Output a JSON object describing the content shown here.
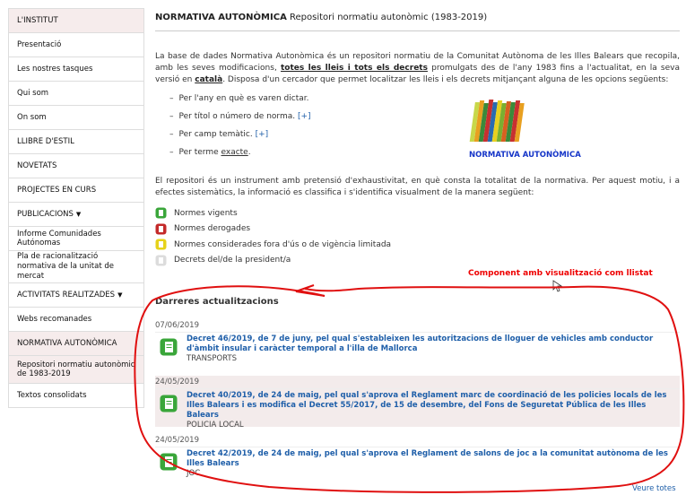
{
  "sidebar": {
    "items": [
      {
        "label": "L'INSTITUT",
        "type": "head"
      },
      {
        "label": "Presentació"
      },
      {
        "label": "Les nostres tasques"
      },
      {
        "label": "Qui som"
      },
      {
        "label": "On som"
      },
      {
        "label": "LLIBRE D'ESTIL"
      },
      {
        "label": "NOVETATS"
      },
      {
        "label": "PROJECTES EN CURS"
      },
      {
        "label": "PUBLICACIONS"
      },
      {
        "label": "Informe Comunidades Autónomas"
      },
      {
        "label": "Pla de racionalització normativa de la unitat de mercat"
      },
      {
        "label": "ACTIVITATS REALITZADES"
      },
      {
        "label": "Webs recomanades"
      },
      {
        "label": "NORMATIVA AUTONÒMICA"
      },
      {
        "label": "Repositori normatiu autonòmic de 1983-2019"
      },
      {
        "label": "Textos consolidats"
      }
    ],
    "caret": "▼"
  },
  "main": {
    "title_bold": "NORMATIVA AUTONÒMICA",
    "title_rest": " Repositori normatiu autonòmic (1983-2019)",
    "intro_1": "La base de dades Normativa Autonòmica és un repositori normatiu de la Comunitat Autònoma de les Illes Balears que recopila, amb les seves modificacions, ",
    "intro_link": "totes les lleis i tots els decrets",
    "intro_2": " promulgats des de l'any 1983 fins a l'actualitat, en la seva versió en ",
    "intro_lang": "català",
    "intro_3": ". Disposa d'un cercador que permet localitzar les lleis i els decrets mitjançant alguna de les opcions següents:",
    "options": [
      {
        "text": "Per l'any en què es varen dictar.",
        "extra": ""
      },
      {
        "text": "Per títol o número de norma. ",
        "extra": "[+]"
      },
      {
        "text": "Per camp temàtic. ",
        "extra": "[+]"
      },
      {
        "text": "Per terme ",
        "extra_underline": "exacte",
        "tail": "."
      }
    ],
    "dash": "–",
    "books_label": "NORMATIVA AUTONÒMICA",
    "para2": "El repositori és un instrument amb pretensió d'exhaustivitat, en què consta la totalitat de la normativa. Per aquest motiu, i a efectes sistemàtics, la informació es classifica i s'identifica visualment de la manera següent:",
    "legend": [
      {
        "label": "Normes vigents",
        "color": "#3aa63a"
      },
      {
        "label": "Normes derogades",
        "color": "#c42a2a"
      },
      {
        "label": "Normes considerades fora d'ús o de vigència limitada",
        "color": "#e6d21a"
      },
      {
        "label": "Decrets del/de la president/a",
        "color": "#dcdcdc"
      }
    ]
  },
  "annotation": "Component amb visualització com llistat",
  "updates": {
    "title": "Darreres actualitzacions",
    "entries": [
      {
        "date": "07/06/2019",
        "link": "Decret 46/2019, de 7 de juny, pel qual s'estableixen les autoritzacions de lloguer de vehicles amb conductor d'àmbit insular i caràcter temporal a l'illa de Mallorca",
        "category": "TRANSPORTS"
      },
      {
        "date": "24/05/2019",
        "link": "Decret 40/2019, de 24 de maig, pel qual s'aprova el Reglament marc de coordinació de les policies locals de les Illes Balears i es modifica el Decret 55/2017, de 15 de desembre, del Fons de Seguretat Pública de les Illes Balears",
        "category": "POLICIA LOCAL"
      },
      {
        "date": "24/05/2019",
        "link": "Decret 42/2019, de 24 de maig, pel qual s'aprova el Reglament de salons de joc a la comunitat autònoma de les Illes Balears",
        "category": "JOC"
      }
    ],
    "see_all": "Veure totes"
  }
}
